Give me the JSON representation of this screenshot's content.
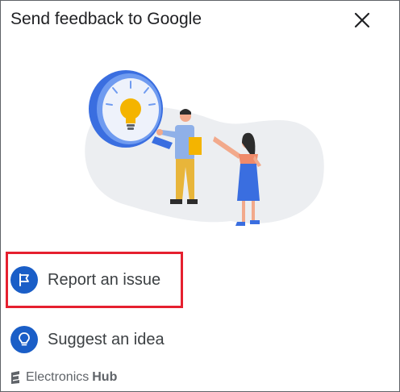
{
  "dialog": {
    "title": "Send feedback to Google",
    "close_icon": "close-icon"
  },
  "options": [
    {
      "label": "Report an issue",
      "icon": "flag-icon",
      "highlighted": true
    },
    {
      "label": "Suggest an idea",
      "icon": "lightbulb-icon",
      "highlighted": false
    }
  ],
  "watermark": {
    "brand": "Electronics",
    "brand_bold": "Hub"
  },
  "colors": {
    "accent_blue": "#1a5ec7",
    "highlight_red": "#e5202f",
    "text": "#3c4043"
  }
}
